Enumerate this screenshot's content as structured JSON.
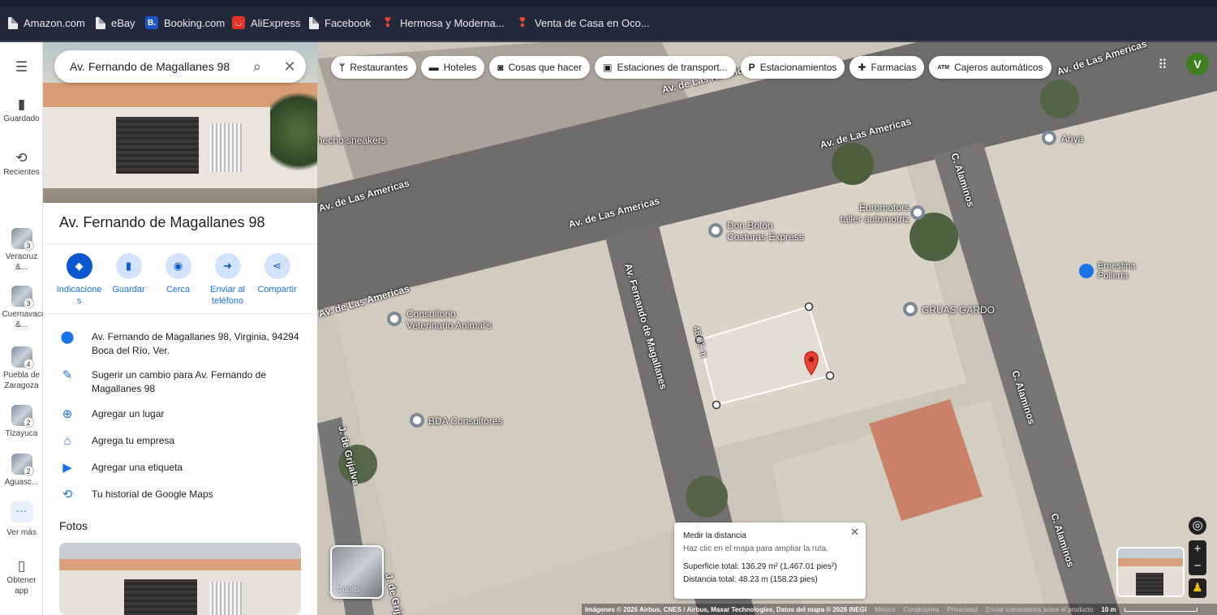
{
  "bookmarks": [
    {
      "label": "Amazon.com",
      "icon": "page-icon"
    },
    {
      "label": "eBay",
      "icon": "page-icon"
    },
    {
      "label": "Booking.com",
      "icon": "booking-icon"
    },
    {
      "label": "AliExpress",
      "icon": "aliexpress-icon"
    },
    {
      "label": "Facebook",
      "icon": "page-icon"
    },
    {
      "label": "Hermosa y Moderna...",
      "icon": "pin-icon"
    },
    {
      "label": "Venta de Casa en Oco...",
      "icon": "pin-icon"
    }
  ],
  "rail": {
    "saved": "Guardado",
    "recent": "Recientes",
    "items": [
      {
        "label": "Veracruz &...",
        "count": "3"
      },
      {
        "label": "Cuernavaca &...",
        "count": "3"
      },
      {
        "label": "Puebla de Zaragoza",
        "count": "4"
      },
      {
        "label": "Tizayuca",
        "count": "2"
      },
      {
        "label": "Aguasc...",
        "count": "2"
      }
    ],
    "more": "Ver más",
    "get_app": "Obtener app"
  },
  "search": {
    "value": "Av. Fernando de Magallanes 98"
  },
  "place": {
    "title": "Av. Fernando de Magallanes 98",
    "actions": [
      "Indicaciones",
      "Guardar",
      "Cerca",
      "Enviar al teléfono",
      "Compartir"
    ],
    "address": "Av. Fernando de Magallanes 98, Virginia, 94294 Boca del Río, Ver.",
    "suggest": "Sugerir un cambio para Av. Fernando de Magallanes 98",
    "add_place": "Agregar un lugar",
    "add_business": "Agrega tu empresa",
    "add_label": "Agregar una etiqueta",
    "history": "Tu historial de Google Maps",
    "photos": "Fotos"
  },
  "map": {
    "chips": [
      {
        "label": "Restaurantes",
        "icon": "fork-knife-icon"
      },
      {
        "label": "Hoteles",
        "icon": "bed-icon"
      },
      {
        "label": "Cosas que hacer",
        "icon": "camera-icon"
      },
      {
        "label": "Estaciones de transport...",
        "icon": "bus-icon"
      },
      {
        "label": "Estacionamientos",
        "icon": "parking-icon"
      },
      {
        "label": "Farmacias",
        "icon": "pharmacy-icon"
      },
      {
        "label": "Cajeros automáticos",
        "icon": "atm-icon"
      }
    ],
    "avatar": "V",
    "roads": {
      "americas": "Av. de Las Americas",
      "magallanes": "Av. Fernando de Magallanes",
      "alaminos": "C. Alaminos",
      "grijalva": "J. de Grijalva",
      "grijalva2": "J. de Grijal"
    },
    "pois": {
      "sneakers": "hecho sneakers",
      "anya": "Anya",
      "euromotors": "Euromotors taller automotriz",
      "donboton": "Don Botón Costuras Express",
      "ernestina": "Ernestina Pollería",
      "gruas": "GRÚAS GARDO",
      "consultorio": "Consultorio Veterinario Animal's",
      "bda": "BDA Consultores"
    },
    "measure_side_label": "48.23 m",
    "measure": {
      "title": "Medir la distancia",
      "hint": "Haz clic en el mapa para ampliar la ruta.",
      "area": "Superficie total: 136.29 m² (1,467.01 pies²)",
      "distance": "Distancia total: 48.23 m (158.23 pies)"
    },
    "layers": "Capas",
    "footer": {
      "imagery": "Imágenes © 2026 Airbus, CNES / Airbus, Maxar Technologies, Datos del mapa © 2026 INEGI",
      "country": "México",
      "terms": "Condiciones",
      "privacy": "Privacidad",
      "feedback": "Enviar comentarios sobre el producto",
      "scale": "10 m"
    }
  },
  "colors": {
    "accent": "#1a73e8",
    "pin": "#ea4335",
    "avatar": "#3f7d20"
  }
}
